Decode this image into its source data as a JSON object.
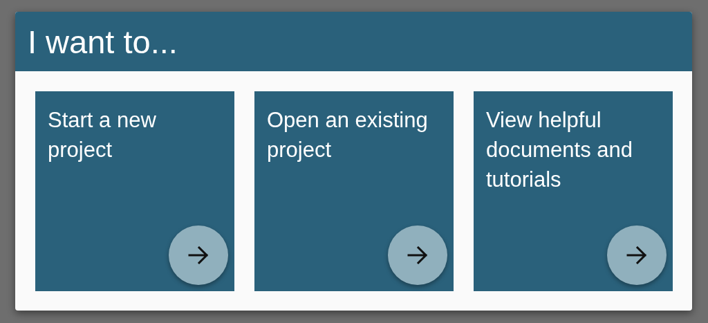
{
  "dialog": {
    "title": "I want to..."
  },
  "cards": [
    {
      "label": "Start a new project"
    },
    {
      "label": "Open an existing project"
    },
    {
      "label": "View helpful documents and tutorials"
    }
  ]
}
